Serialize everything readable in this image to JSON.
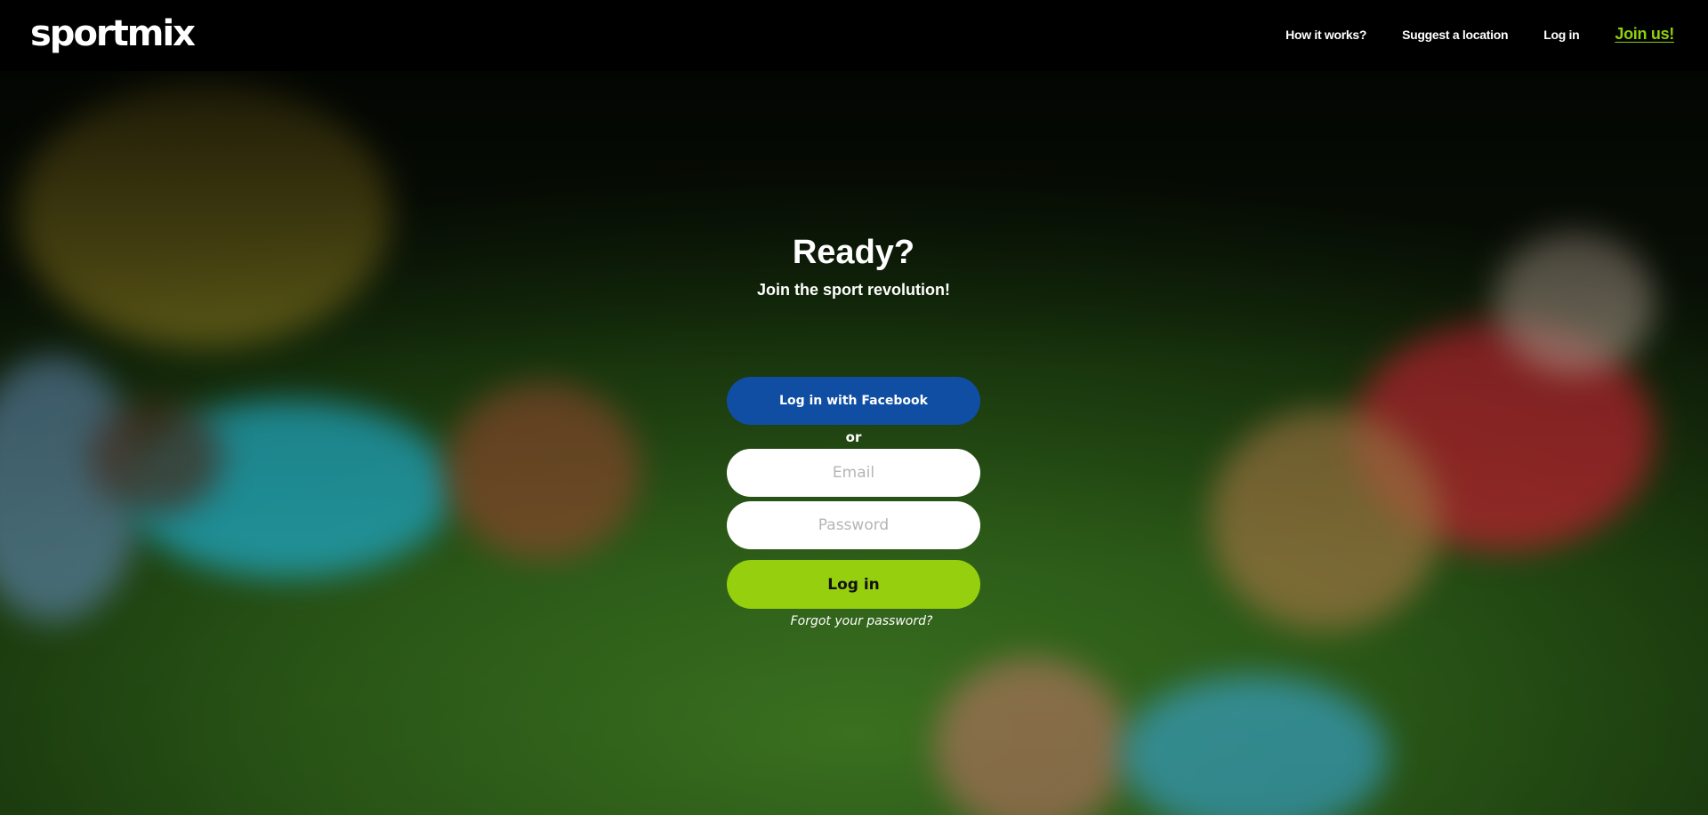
{
  "header": {
    "logo": "sportmix",
    "nav": {
      "how_it_works": "How it works?",
      "suggest_location": "Suggest a location",
      "login": "Log in",
      "join": "Join us!"
    }
  },
  "hero": {
    "title": "Ready?",
    "subtitle": "Join the sport revolution!"
  },
  "login_form": {
    "facebook_button": "Log in with Facebook",
    "separator": "or",
    "email_placeholder": "Email",
    "password_placeholder": "Password",
    "submit_button": "Log in",
    "forgot_link": "Forgot your password?"
  },
  "colors": {
    "accent_green": "#96cf0e",
    "join_link": "#8fd10d",
    "facebook_blue": "#0f4ea3",
    "header_bg": "#000000"
  }
}
